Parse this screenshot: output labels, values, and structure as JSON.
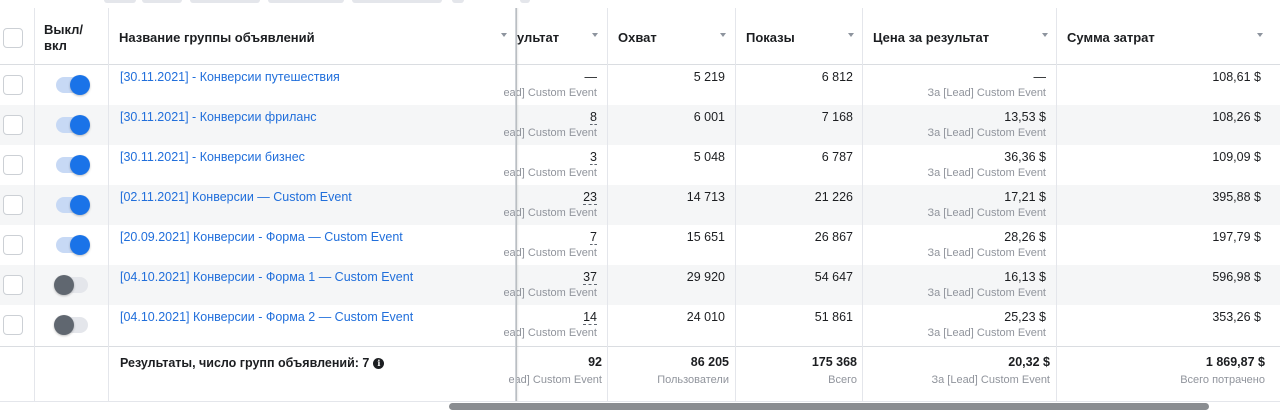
{
  "header": {
    "toggle_label_top": "Выкл/",
    "toggle_label_bottom": "вкл",
    "name": "Название группы объявлений",
    "results": "ультат",
    "reach": "Охват",
    "impressions": "Показы",
    "cost_per_result": "Цена за результат",
    "amount_spent": "Сумма затрат"
  },
  "rows": [
    {
      "name": "[30.11.2021] - Конверсии путешествия",
      "on": true,
      "results": "—",
      "results_sub": "ead] Custom Event",
      "reach": "5 219",
      "impressions": "6 812",
      "cpr": "—",
      "cpr_sub": "За [Lead] Custom Event",
      "spent": "108,61 $"
    },
    {
      "name": "[30.11.2021] - Конверсии фриланс",
      "on": true,
      "results": "8",
      "results_sub": "ead] Custom Event",
      "reach": "6 001",
      "impressions": "7 168",
      "cpr": "13,53 $",
      "cpr_sub": "За [Lead] Custom Event",
      "spent": "108,26 $"
    },
    {
      "name": "[30.11.2021] - Конверсии бизнес",
      "on": true,
      "results": "3",
      "results_sub": "ead] Custom Event",
      "reach": "5 048",
      "impressions": "6 787",
      "cpr": "36,36 $",
      "cpr_sub": "За [Lead] Custom Event",
      "spent": "109,09 $"
    },
    {
      "name": "[02.11.2021] Конверсии — Custom Event",
      "on": true,
      "results": "23",
      "results_sub": "ead] Custom Event",
      "reach": "14 713",
      "impressions": "21 226",
      "cpr": "17,21 $",
      "cpr_sub": "За [Lead] Custom Event",
      "spent": "395,88 $"
    },
    {
      "name": "[20.09.2021] Конверсии - Форма — Custom Event",
      "on": true,
      "results": "7",
      "results_sub": "ead] Custom Event",
      "reach": "15 651",
      "impressions": "26 867",
      "cpr": "28,26 $",
      "cpr_sub": "За [Lead] Custom Event",
      "spent": "197,79 $"
    },
    {
      "name": "[04.10.2021] Конверсии - Форма 1 — Custom Event",
      "on": false,
      "results": "37",
      "results_sub": "ead] Custom Event",
      "reach": "29 920",
      "impressions": "54 647",
      "cpr": "16,13 $",
      "cpr_sub": "За [Lead] Custom Event",
      "spent": "596,98 $"
    },
    {
      "name": "[04.10.2021] Конверсии - Форма 2 — Custom Event",
      "on": false,
      "results": "14",
      "results_sub": "ead] Custom Event",
      "reach": "24 010",
      "impressions": "51 861",
      "cpr": "25,23 $",
      "cpr_sub": "За [Lead] Custom Event",
      "spent": "353,26 $"
    }
  ],
  "footer": {
    "label": "Результаты, число групп объявлений: 7",
    "info_icon": "i",
    "results": "92",
    "results_sub": "ead] Custom Event",
    "reach": "86 205",
    "reach_sub": "Пользователи",
    "impressions": "175 368",
    "impressions_sub": "Всего",
    "cpr": "20,32 $",
    "cpr_sub": "За [Lead] Custom Event",
    "spent": "1 869,87 $",
    "spent_sub": "Всего потрачено"
  },
  "colors": {
    "link": "#216fdb",
    "toggle_on": "#1a73e8",
    "toggle_off": "#606770",
    "row_alt": "#f5f6f7"
  }
}
